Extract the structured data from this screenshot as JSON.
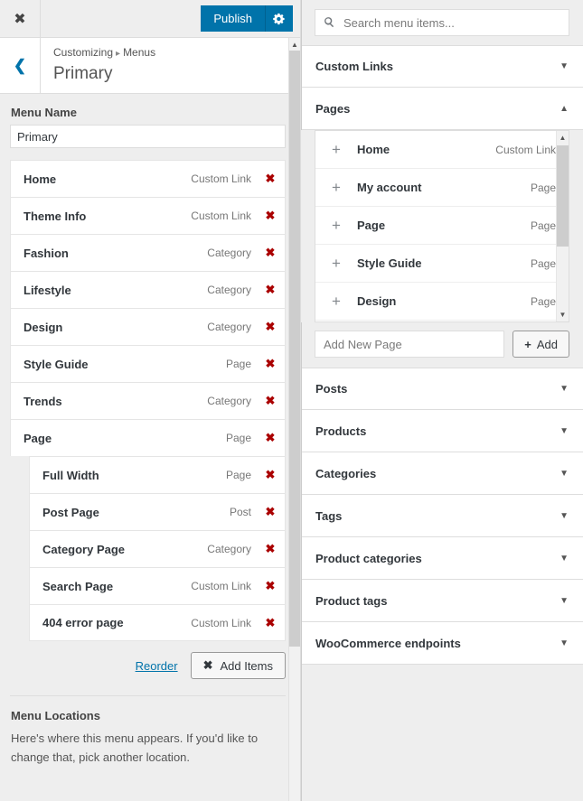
{
  "topbar": {
    "close_icon": "close-icon",
    "publish_label": "Publish",
    "gear_icon": "gear-icon"
  },
  "header": {
    "back_icon": "chevron-left-icon",
    "breadcrumb_root": "Customizing",
    "breadcrumb_separator": "▸",
    "breadcrumb_section": "Menus",
    "title": "Primary"
  },
  "menu_name": {
    "label": "Menu Name",
    "value": "Primary"
  },
  "menu_items": [
    {
      "title": "Home",
      "type": "Custom Link",
      "child": false
    },
    {
      "title": "Theme Info",
      "type": "Custom Link",
      "child": false
    },
    {
      "title": "Fashion",
      "type": "Category",
      "child": false
    },
    {
      "title": "Lifestyle",
      "type": "Category",
      "child": false
    },
    {
      "title": "Design",
      "type": "Category",
      "child": false
    },
    {
      "title": "Style Guide",
      "type": "Page",
      "child": false
    },
    {
      "title": "Trends",
      "type": "Category",
      "child": false
    },
    {
      "title": "Page",
      "type": "Page",
      "child": false
    },
    {
      "title": "Full Width",
      "type": "Page",
      "child": true
    },
    {
      "title": "Post Page",
      "type": "Post",
      "child": true
    },
    {
      "title": "Category Page",
      "type": "Category",
      "child": true
    },
    {
      "title": "Search Page",
      "type": "Custom Link",
      "child": true
    },
    {
      "title": "404 error page",
      "type": "Custom Link",
      "child": true
    }
  ],
  "menu_actions": {
    "reorder_label": "Reorder",
    "add_items_icon": "✖",
    "add_items_label": "Add Items"
  },
  "menu_locations": {
    "title": "Menu Locations",
    "description": "Here's where this menu appears. If you'd like to change that, pick another location."
  },
  "available": {
    "search_placeholder": "Search menu items...",
    "search_value": "",
    "search_icon": "search-icon",
    "sections": [
      {
        "label": "Custom Links",
        "expanded": false,
        "arrow": "▼"
      },
      {
        "label": "Pages",
        "expanded": true,
        "arrow": "▲"
      },
      {
        "label": "Posts",
        "expanded": false,
        "arrow": "▼"
      },
      {
        "label": "Products",
        "expanded": false,
        "arrow": "▼"
      },
      {
        "label": "Categories",
        "expanded": false,
        "arrow": "▼"
      },
      {
        "label": "Tags",
        "expanded": false,
        "arrow": "▼"
      },
      {
        "label": "Product categories",
        "expanded": false,
        "arrow": "▼"
      },
      {
        "label": "Product tags",
        "expanded": false,
        "arrow": "▼"
      },
      {
        "label": "WooCommerce endpoints",
        "expanded": false,
        "arrow": "▼"
      }
    ],
    "pages_items": [
      {
        "title": "Home",
        "type": "Custom Link",
        "plus": "+"
      },
      {
        "title": "My account",
        "type": "Page",
        "plus": "+"
      },
      {
        "title": "Page",
        "type": "Page",
        "plus": "+"
      },
      {
        "title": "Style Guide",
        "type": "Page",
        "plus": "+"
      },
      {
        "title": "Design",
        "type": "Page",
        "plus": "+"
      }
    ],
    "add_new": {
      "placeholder": "Add New Page",
      "value": "",
      "button_icon": "+",
      "button_label": "Add"
    }
  },
  "annotation": {
    "highlight_color": "#ef1a62",
    "target": "add-item-plus-buttons"
  },
  "colors": {
    "accent_blue": "#0073aa",
    "delete_red": "#aa0000",
    "panel_bg": "#eeeeee",
    "highlight_pink": "#ef1a62"
  }
}
